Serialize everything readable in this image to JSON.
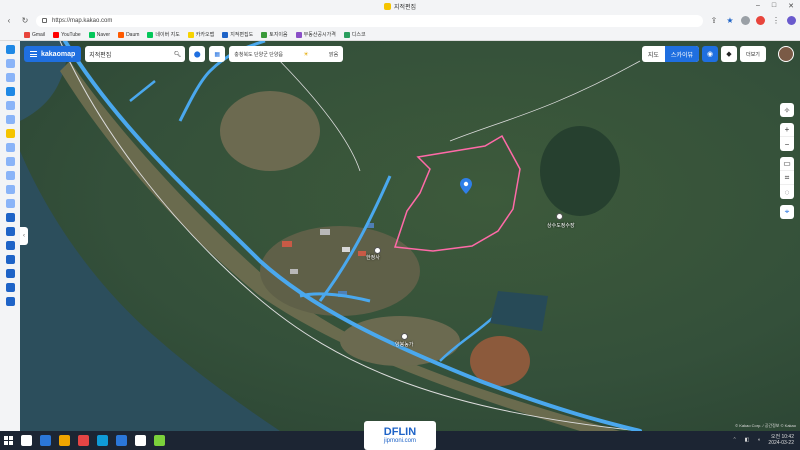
{
  "browser": {
    "window_title": "지적편집",
    "url": "https://map.kakao.com",
    "bookmarks": [
      {
        "label": "Gmail",
        "color": "#e8453c"
      },
      {
        "label": "YouTube",
        "color": "#ff0000"
      },
      {
        "label": "Naver",
        "color": "#03c75a"
      },
      {
        "label": "Daum",
        "color": "#ff5a00"
      },
      {
        "label": "네이버 지도",
        "color": "#03c75a"
      },
      {
        "label": "카카오맵",
        "color": "#f7d300"
      },
      {
        "label": "지적편집도",
        "color": "#1e63c7"
      },
      {
        "label": "토지이음",
        "color": "#3a9a3a"
      },
      {
        "label": "부동산공시가격",
        "color": "#8a4fc7"
      },
      {
        "label": "디스코",
        "color": "#2a9e5e"
      }
    ]
  },
  "sidebar_icons": [
    "#1e88e5",
    "#8ab4f8",
    "#8ab4f8",
    "#1e88e5",
    "#8ab4f8",
    "#8ab4f8",
    "#f5c400",
    "#8ab4f8",
    "#8ab4f8",
    "#8ab4f8",
    "#8ab4f8",
    "#8ab4f8",
    "#1e63c7",
    "#1e63c7",
    "#1e63c7",
    "#1e63c7",
    "#1e63c7",
    "#1e63c7",
    "#1e63c7"
  ],
  "map": {
    "logo": "kakaomap",
    "search_value": "지적편집",
    "address_text": "충청북도 단양군 단양읍",
    "weather": "맑음",
    "map_types": [
      {
        "label": "지도",
        "active": false
      },
      {
        "label": "스카이뷰",
        "active": true
      }
    ],
    "more_label": "더보기",
    "labels": [
      "상수도정수장",
      "한정사",
      "양봉농가"
    ],
    "copyright": "© Kakao Corp. / 공간정보 © Kakao"
  },
  "taskbar": {
    "icons": [
      "#ffffff",
      "#2b77d9",
      "#f0a500",
      "#e54545",
      "#0f9bd7",
      "#2b77d9",
      "#ffffff",
      "#7bd13b"
    ],
    "time": "오전 10:42",
    "date": "2024-03-22"
  },
  "watermark": {
    "logo": "DFLIN",
    "sub": "jipmoni.com"
  }
}
